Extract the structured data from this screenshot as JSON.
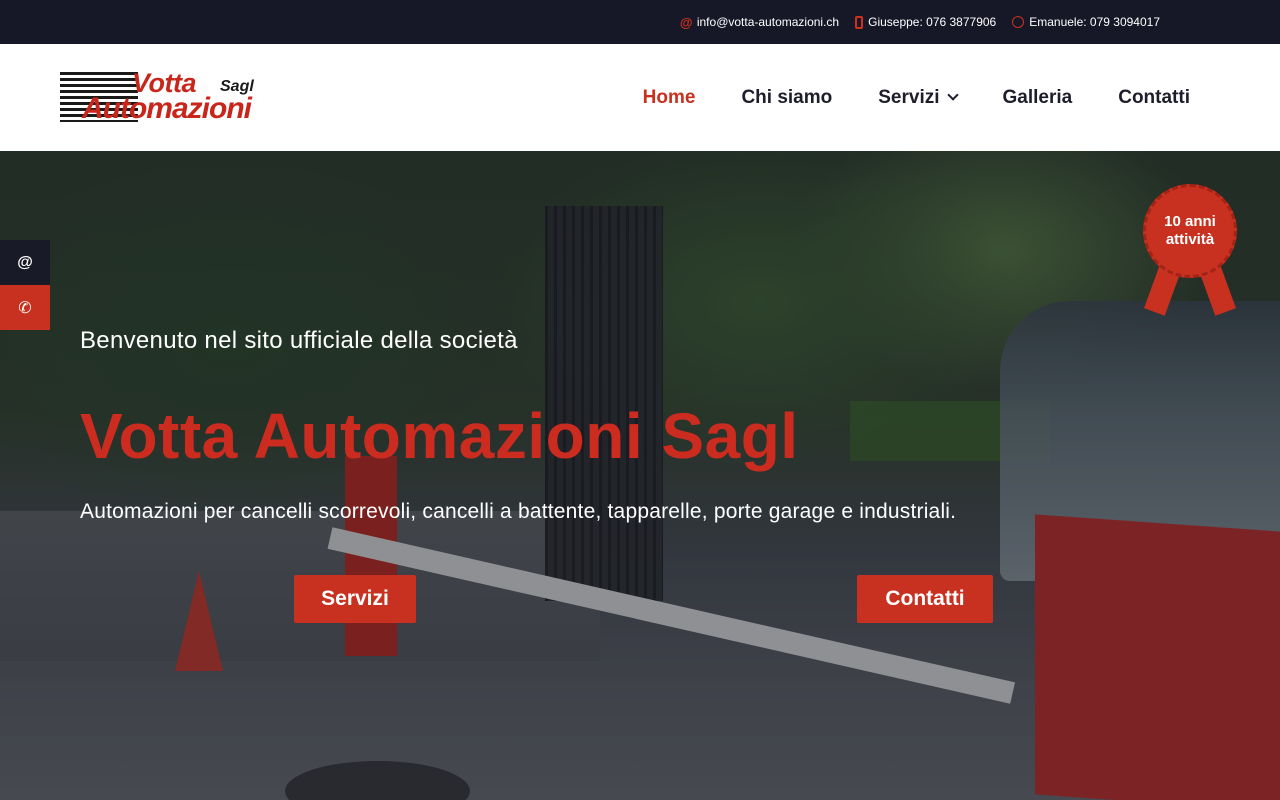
{
  "topbar": {
    "email": "info@votta-automazioni.ch",
    "phone1": "Giuseppe: 076 3877906",
    "phone2": "Emanuele: 079 3094017"
  },
  "logo": {
    "word1": "Votta",
    "word2": "Sagl",
    "word3": "Automazioni"
  },
  "nav": {
    "items": [
      {
        "label": "Home",
        "active": true
      },
      {
        "label": "Chi siamo"
      },
      {
        "label": "Servizi",
        "has_dropdown": true
      },
      {
        "label": "Galleria"
      },
      {
        "label": "Contatti"
      }
    ]
  },
  "hero": {
    "welcome": "Benvenuto nel sito ufficiale della società",
    "title": "Votta Automazioni Sagl",
    "tagline": "Automazioni per cancelli scorrevoli, cancelli a battente, tapparelle, porte garage e industriali.",
    "btn_servizi": "Servizi",
    "btn_contatti": "Contatti"
  },
  "badge": {
    "line1": "10 anni",
    "line2": "attività"
  },
  "side": {
    "email_icon": "@",
    "phone_icon": "✆"
  },
  "icons": {
    "topbar_email": "at-icon",
    "topbar_phone": "mobile-phone-icon",
    "topbar_whatsapp": "whatsapp-icon",
    "nav_servizi": "chevron-down-icon"
  },
  "colors": {
    "accent": "#c8311f",
    "dark": "#171827",
    "nav_text": "#1d1d2b"
  }
}
